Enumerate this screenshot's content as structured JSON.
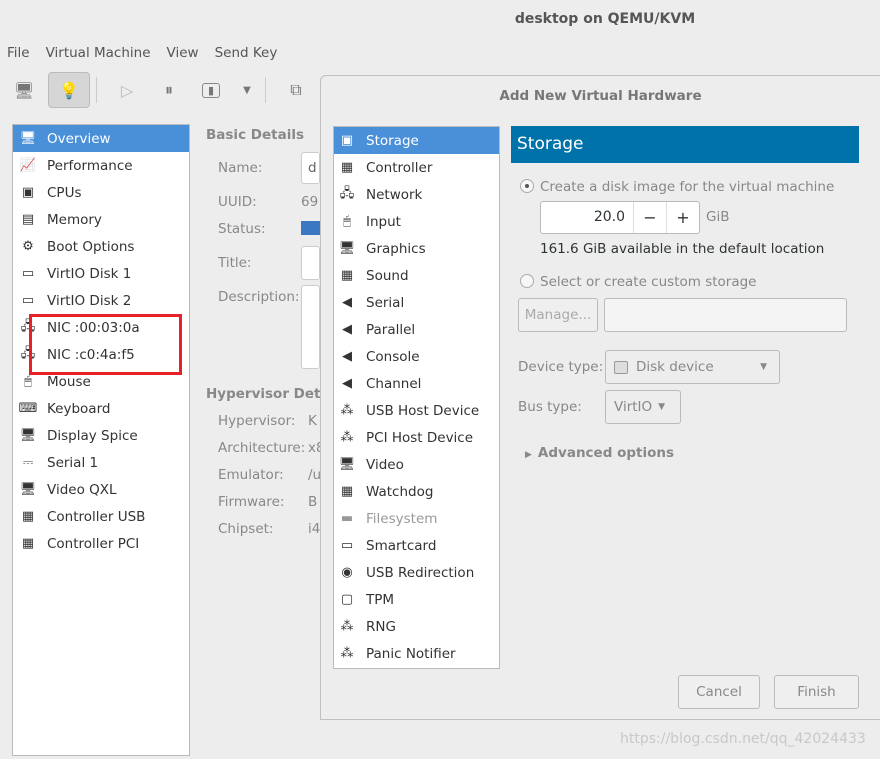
{
  "window": {
    "title": "desktop on QEMU/KVM"
  },
  "menu": [
    "File",
    "Virtual Machine",
    "View",
    "Send Key"
  ],
  "sidebar": {
    "items": [
      {
        "label": "Overview",
        "icon": "monitor-icon",
        "selected": true
      },
      {
        "label": "Performance",
        "icon": "performance-icon"
      },
      {
        "label": "CPUs",
        "icon": "cpu-icon"
      },
      {
        "label": "Memory",
        "icon": "memory-icon"
      },
      {
        "label": "Boot Options",
        "icon": "gears-icon"
      },
      {
        "label": "VirtIO Disk 1",
        "icon": "disk-icon"
      },
      {
        "label": "VirtIO Disk 2",
        "icon": "disk-icon"
      },
      {
        "label": "NIC :00:03:0a",
        "icon": "network-icon"
      },
      {
        "label": "NIC :c0:4a:f5",
        "icon": "network-icon"
      },
      {
        "label": "Mouse",
        "icon": "mouse-icon"
      },
      {
        "label": "Keyboard",
        "icon": "keyboard-icon"
      },
      {
        "label": "Display Spice",
        "icon": "monitor-icon"
      },
      {
        "label": "Serial 1",
        "icon": "serial-icon"
      },
      {
        "label": "Video QXL",
        "icon": "monitor-icon"
      },
      {
        "label": "Controller USB",
        "icon": "controller-icon"
      },
      {
        "label": "Controller PCI",
        "icon": "controller-icon"
      }
    ]
  },
  "details": {
    "basic_title": "Basic Details",
    "name_label": "Name:",
    "name_value": "d",
    "uuid_label": "UUID:",
    "uuid_value": "69",
    "status_label": "Status:",
    "title_label": "Title:",
    "desc_label": "Description:",
    "hyper_title": "Hypervisor Details",
    "rows": [
      {
        "label": "Hypervisor:",
        "value": "K"
      },
      {
        "label": "Architecture:",
        "value": "x8"
      },
      {
        "label": "Emulator:",
        "value": "/u"
      },
      {
        "label": "Firmware:",
        "value": "B"
      },
      {
        "label": "Chipset:",
        "value": "i4"
      }
    ]
  },
  "dialog": {
    "title": "Add New Virtual Hardware",
    "hardware": [
      {
        "label": "Storage",
        "icon": "storage-icon",
        "selected": true
      },
      {
        "label": "Controller",
        "icon": "controller-icon"
      },
      {
        "label": "Network",
        "icon": "network-icon"
      },
      {
        "label": "Input",
        "icon": "mouse-icon"
      },
      {
        "label": "Graphics",
        "icon": "monitor-icon"
      },
      {
        "label": "Sound",
        "icon": "sound-icon"
      },
      {
        "label": "Serial",
        "icon": "plug-icon"
      },
      {
        "label": "Parallel",
        "icon": "plug-icon"
      },
      {
        "label": "Console",
        "icon": "plug-icon"
      },
      {
        "label": "Channel",
        "icon": "plug-icon"
      },
      {
        "label": "USB Host Device",
        "icon": "device-icon"
      },
      {
        "label": "PCI Host Device",
        "icon": "device-icon"
      },
      {
        "label": "Video",
        "icon": "monitor-icon"
      },
      {
        "label": "Watchdog",
        "icon": "controller-icon"
      },
      {
        "label": "Filesystem",
        "icon": "folder-icon",
        "disabled": true
      },
      {
        "label": "Smartcard",
        "icon": "smartcard-icon"
      },
      {
        "label": "USB Redirection",
        "icon": "usb-icon"
      },
      {
        "label": "TPM",
        "icon": "chip-icon"
      },
      {
        "label": "RNG",
        "icon": "device-icon"
      },
      {
        "label": "Panic Notifier",
        "icon": "device-icon"
      }
    ],
    "storage": {
      "header": "Storage",
      "create_label": "Create a disk image for the virtual machine",
      "size_value": "20.0",
      "unit": "GiB",
      "minus": "−",
      "plus": "+",
      "available": "161.6 GiB available in the default location",
      "custom_label": "Select or create custom storage",
      "manage_label": "Manage...",
      "device_type_label": "Device type:",
      "device_type_value": "Disk device",
      "bus_type_label": "Bus type:",
      "bus_type_value": "VirtIO",
      "advanced_label": "Advanced options"
    },
    "cancel_label": "Cancel",
    "finish_label": "Finish"
  },
  "watermark": "https://blog.csdn.net/qq_42024433",
  "colors": {
    "selection": "#4a90d9",
    "header": "#0072aa",
    "highlight_box": "#e8202a"
  }
}
